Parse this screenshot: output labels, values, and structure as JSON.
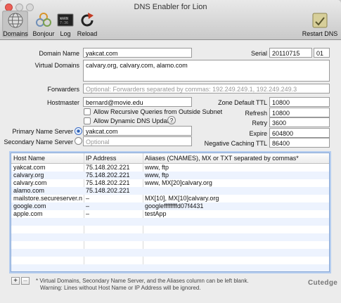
{
  "window": {
    "title": "DNS Enabler for Lion"
  },
  "toolbar": {
    "domains_label": "Domains",
    "bonjour_label": "Bonjour",
    "log_label": "Log",
    "reload_label": "Reload",
    "restart_label": "Restart DNS"
  },
  "form": {
    "domain_name_label": "Domain Name",
    "domain_name_value": "yakcat.com",
    "serial_label": "Serial",
    "serial_value": "20110715",
    "serial_suffix": "01",
    "virtual_domains_label": "Virtual Domains",
    "virtual_domains_value": "calvary.org, calvary.com, alamo.com",
    "forwarders_label": "Forwarders",
    "forwarders_placeholder": "Optional: Forwarders separated by commas: 192.249.249.1, 192.249.249.3",
    "hostmaster_label": "Hostmaster",
    "hostmaster_value": "bernard@movie.edu",
    "recursive_label": "Allow Recursive Queries from Outside Subnet",
    "dynamic_label": "Allow Dynamic DNS Updates",
    "help_symbol": "?",
    "primary_label": "Primary Name Server",
    "primary_value": "yakcat.com",
    "secondary_label": "Secondary Name Server",
    "secondary_placeholder": "Optional",
    "zone_ttl_label": "Zone Default TTL",
    "zone_ttl_value": "10800",
    "refresh_label": "Refresh",
    "refresh_value": "10800",
    "retry_label": "Retry",
    "retry_value": "3600",
    "expire_label": "Expire",
    "expire_value": "604800",
    "neg_ttl_label": "Negative Caching TTL",
    "neg_ttl_value": "86400"
  },
  "table": {
    "headers": [
      "Host Name",
      "IP Address",
      "Aliases (CNAMES), MX or TXT separated by commas*"
    ],
    "rows": [
      [
        "yakcat.com",
        "75.148.202.221",
        "www, ftp"
      ],
      [
        "calvary.org",
        "75.148.202.221",
        "www, ftp"
      ],
      [
        "calvary.com",
        "75.148.202.221",
        "www, MX[20]calvary.org"
      ],
      [
        "alamo.com",
        "75.148.202.221",
        ""
      ],
      [
        "mailstore.secureserver.net",
        "–",
        "MX[10], MX[10]calvary.org"
      ],
      [
        "google.com",
        "–",
        "googleffffffffd07f4431"
      ],
      [
        "apple.com",
        "–",
        "testApp"
      ]
    ]
  },
  "footer": {
    "add_label": "+",
    "remove_label": "–",
    "note_line1": "* Virtual Domains, Secondary Name Server, and the Aliases column can be left blank.",
    "note_line2": "Warning: Lines without Host Name or IP Address will be ignored.",
    "brand": "Cutedge"
  },
  "colors": {
    "close": "#ec5f57",
    "minimize": "#dcdcdc",
    "zoom": "#dcdcdc",
    "row_alt": "#edf3fe",
    "table_focus": "#b5cdef"
  }
}
